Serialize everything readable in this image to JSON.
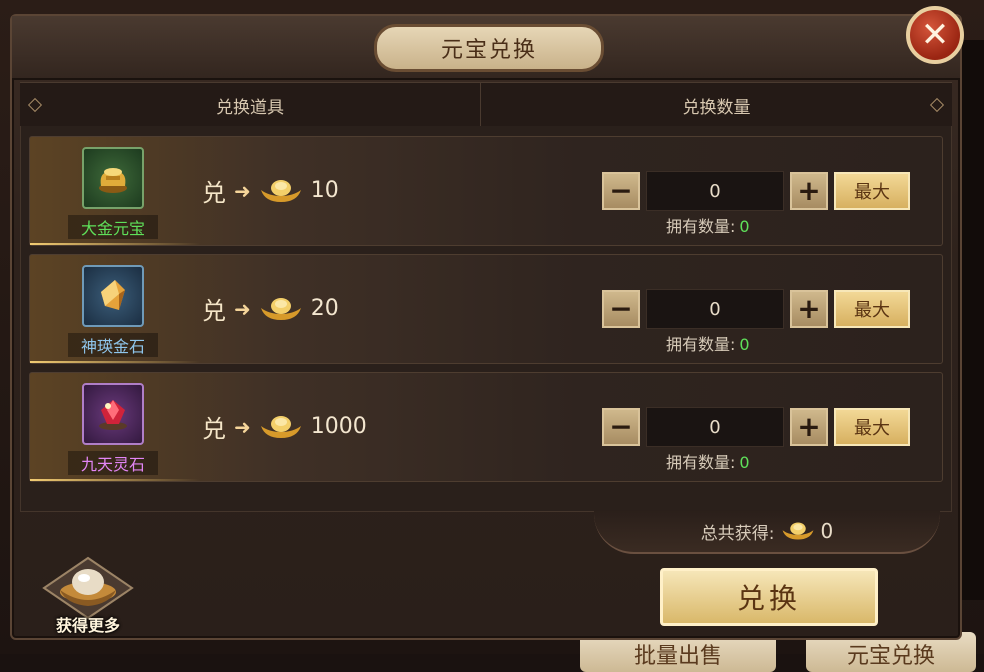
{
  "dialog": {
    "title": "元宝兑换",
    "close_icon": "✕",
    "header": {
      "col_item": "兑换道具",
      "col_qty": "兑换数量"
    },
    "rows": [
      {
        "item_name": "大金元宝",
        "rarity": "green",
        "ex_char": "兑",
        "rate": "10",
        "qty": "0",
        "owned_label": "拥有数量:",
        "owned": "0",
        "max_label": "最大",
        "icon": "gold-ingot-icon"
      },
      {
        "item_name": "神瑛金石",
        "rarity": "blue",
        "ex_char": "兑",
        "rate": "20",
        "qty": "0",
        "owned_label": "拥有数量:",
        "owned": "0",
        "max_label": "最大",
        "icon": "gold-crystal-icon"
      },
      {
        "item_name": "九天灵石",
        "rarity": "purple",
        "ex_char": "兑",
        "rate": "1000",
        "qty": "0",
        "owned_label": "拥有数量:",
        "owned": "0",
        "max_label": "最大",
        "icon": "spirit-gem-icon"
      }
    ],
    "total_label": "总共获得:",
    "total_value": "0",
    "exchange_button": "兑换",
    "get_more_label": "获得更多"
  },
  "background": {
    "bottom_left_button": "批量出售",
    "bottom_right_button": "元宝兑换"
  },
  "colors": {
    "accent_gold": "#d9b86a",
    "green_value": "#5fe05a"
  }
}
